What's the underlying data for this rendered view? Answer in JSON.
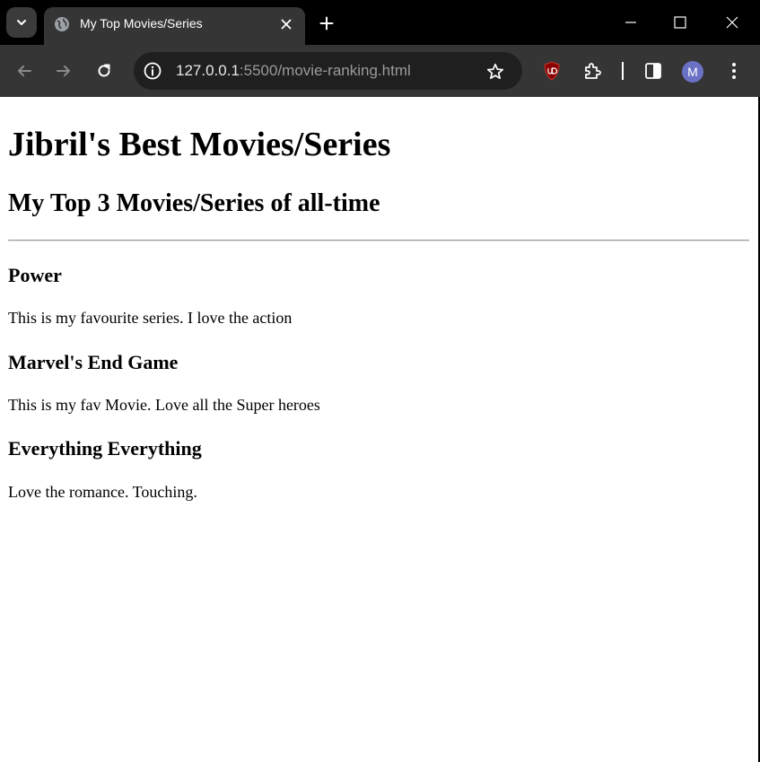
{
  "browser": {
    "tab": {
      "title": "My Top Movies/Series",
      "favicon": "globe-icon"
    },
    "address_bar": {
      "url_host": "127.0.0.1",
      "url_rest": ":5500/movie-ranking.html"
    },
    "profile_initial": "M",
    "colors": {
      "tabstrip": "#000000",
      "toolbar": "#353535",
      "omnibox": "#1f1f1f",
      "avatar": "#6a71c4",
      "ublock": "#8b0000"
    }
  },
  "page": {
    "heading": "Jibril's Best Movies/Series",
    "subheading": "My Top 3 Movies/Series of all-time",
    "entries": [
      {
        "title": "Power",
        "description": "This is my favourite series. I love the action"
      },
      {
        "title": "Marvel's End Game",
        "description": "This is my fav Movie. Love all the Super heroes"
      },
      {
        "title": "Everything Everything",
        "description": "Love the romance. Touching."
      }
    ]
  }
}
